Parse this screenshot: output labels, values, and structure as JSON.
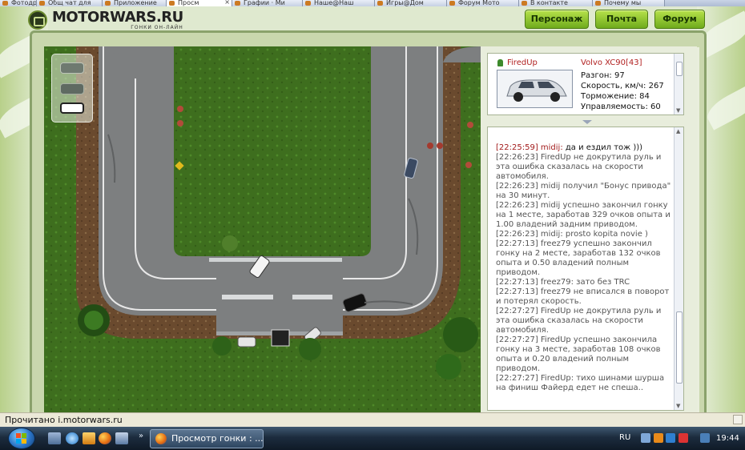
{
  "browser": {
    "tabs": [
      {
        "label": "Фотодр",
        "active": false
      },
      {
        "label": "Общ чат для",
        "active": false
      },
      {
        "label": "Приложение",
        "active": false
      },
      {
        "label": "Просм",
        "active": true
      },
      {
        "label": "Графии · Ми",
        "active": false
      },
      {
        "label": "Наше@Наш",
        "active": false
      },
      {
        "label": "Игры@Дом",
        "active": false
      },
      {
        "label": "Форум Мото",
        "active": false
      },
      {
        "label": "В контакте",
        "active": false
      },
      {
        "label": "Почему мы",
        "active": false
      }
    ]
  },
  "site": {
    "logo_name": "MOTORWARS.RU",
    "logo_subtitle": "ГОНКИ ОН-ЛАЙН",
    "nav": [
      {
        "label": "Персонаж"
      },
      {
        "label": "Почта"
      },
      {
        "label": "Форум"
      }
    ]
  },
  "game": {
    "car_selector": [
      "camera-top",
      "camera-side",
      "camera-close"
    ]
  },
  "info": {
    "player": "FiredUp",
    "car": "Volvo XC90[43]",
    "stats": [
      {
        "label": "Разгон",
        "value": "97"
      },
      {
        "label": "Скорость, км/ч",
        "value": "267"
      },
      {
        "label": "Торможение",
        "value": "84"
      },
      {
        "label": "Управляемость",
        "value": "60"
      }
    ]
  },
  "chat": [
    {
      "text": "[22:25:59] midij: ",
      "msg": "да и ездил тож )))",
      "hl": true
    },
    {
      "text": "[22:26:23] FiredUp не докрутила руль и эта ошибка сказалась на скорости автомобиля.",
      "msg": "",
      "hl": false
    },
    {
      "text": "[22:26:23] midij получил \"Бонус привода\" на 30 минут.",
      "msg": "",
      "hl": false
    },
    {
      "text": "[22:26:23] midij успешно закончил гонку на 1 месте, заработав 329 очков опыта и 1.00 владений задним приводом.",
      "msg": "",
      "hl": false
    },
    {
      "text": "[22:26:23] midij: prosto kopita novie )",
      "msg": "",
      "hl": false
    },
    {
      "text": "[22:27:13] freez79 успешно закончил гонку на 2 месте, заработав 132 очков опыта и 0.50 владений полным приводом.",
      "msg": "",
      "hl": false
    },
    {
      "text": "[22:27:13] freez79: зато без TRC",
      "msg": "",
      "hl": false
    },
    {
      "text": "[22:27:13] freez79 не вписался в поворот и потерял скорость.",
      "msg": "",
      "hl": false
    },
    {
      "text": "[22:27:27] FiredUp не докрутила руль и эта ошибка сказалась на скорости автомобиля.",
      "msg": "",
      "hl": false
    },
    {
      "text": "[22:27:27] FiredUp успешно закончила гонку на 3 месте, заработав 108 очков опыта и 0.20 владений полным приводом.",
      "msg": "",
      "hl": false
    },
    {
      "text": "[22:27:27] FiredUp: тихо шинами шурша на финиш Файерд едет не спеша..",
      "msg": "",
      "hl": false
    }
  ],
  "status": {
    "text": "Прочитано i.motorwars.ru"
  },
  "taskbar": {
    "show_more": "»",
    "task_label": "Просмотр гонки : ...",
    "lang": "RU",
    "clock": "19:44"
  }
}
